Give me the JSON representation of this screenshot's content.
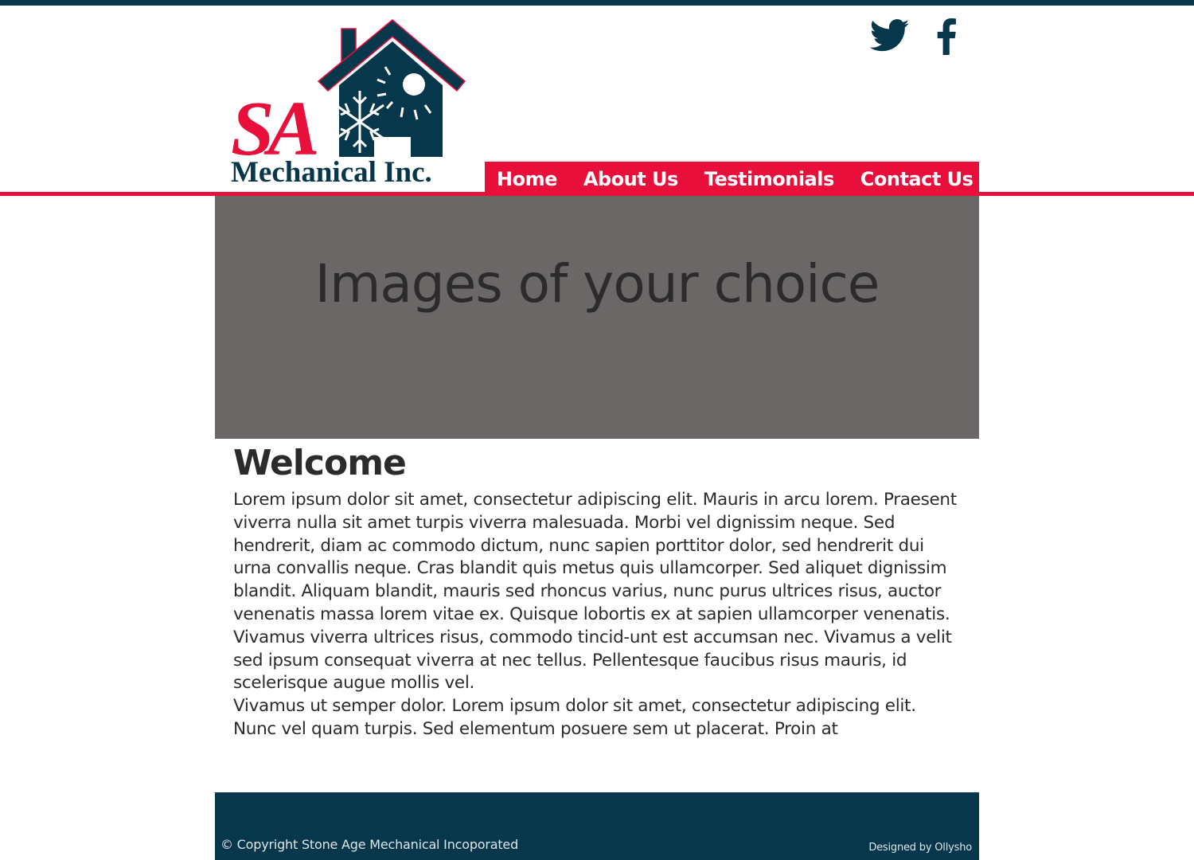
{
  "colors": {
    "navy": "#07374b",
    "red": "#e8103b",
    "banner_gray": "#6b6766"
  },
  "logo": {
    "letters": "SA",
    "caption": "Mechanical Inc."
  },
  "social": [
    {
      "name": "twitter",
      "icon": "twitter-bird-icon"
    },
    {
      "name": "facebook",
      "icon": "facebook-f-icon"
    }
  ],
  "nav": {
    "home": "Home",
    "about": "About Us",
    "testimonials": "Testimonials",
    "contact": "Contact Us"
  },
  "banner": {
    "text": "Images of your choice"
  },
  "welcome": {
    "title": "Welcome",
    "paragraphs": [
      "Lorem ipsum dolor sit amet, consectetur adipiscing elit. Mauris in arcu lorem. Praesent viverra nulla sit amet turpis viverra malesuada. Morbi vel dignissim neque. Sed hendrerit, diam ac commodo dictum, nunc sapien porttitor dolor, sed hendrerit dui urna convallis neque. Cras blandit quis metus quis ullamcorper. Sed aliquet dignissim blandit. Aliquam blandit, mauris sed rhoncus varius, nunc purus ultrices risus, auctor venenatis massa lorem vitae ex. Quisque lobortis ex at sapien ullamcorper venenatis. Vivamus viverra ultrices risus, commodo tincid-unt est accumsan nec. Vivamus a velit sed ipsum consequat viverra at nec tellus. Pellentesque faucibus risus mauris, id scelerisque augue mollis vel.",
      "Vivamus ut semper dolor. Lorem ipsum dolor sit amet, consectetur adipiscing elit. Nunc vel quam turpis. Sed elementum posuere sem ut placerat. Proin at"
    ]
  },
  "footer": {
    "copyright": "© Copyright Stone Age Mechanical Incoporated",
    "designer": "Designed by Ollysho"
  }
}
